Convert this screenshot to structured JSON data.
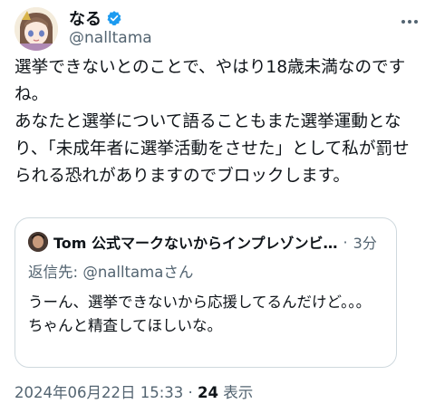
{
  "author": {
    "display_name": "なる",
    "handle": "@nalltama",
    "verified": true
  },
  "tweet": {
    "text": "選挙できないとのことで、やはり18歳未満なのですね。\nあなたと選挙について語ることもまた選挙運動となり、「未成年者に選挙活動をさせた」として私が罰せられる恐れがありますのでブロックします。"
  },
  "quote": {
    "author_name": "Tom 公式マークないからインプレゾンビ…",
    "separator": "·",
    "time": "3分",
    "reply_prefix": "返信先: ",
    "reply_to": "@nalltamaさん",
    "text": "うーん、選挙できないから応援してるんだけど。。。\nちゃんと精査してほしいな。"
  },
  "meta": {
    "timestamp": "2024年06月22日 15:33",
    "separator": " · ",
    "views_count": "24",
    "views_label": " 表示"
  },
  "colors": {
    "text": "#0f1419",
    "secondary": "#536471",
    "border": "#cfd9de",
    "verified": "#1d9bf0"
  },
  "icons": [
    "verified-badge-icon",
    "more-options-icon"
  ]
}
